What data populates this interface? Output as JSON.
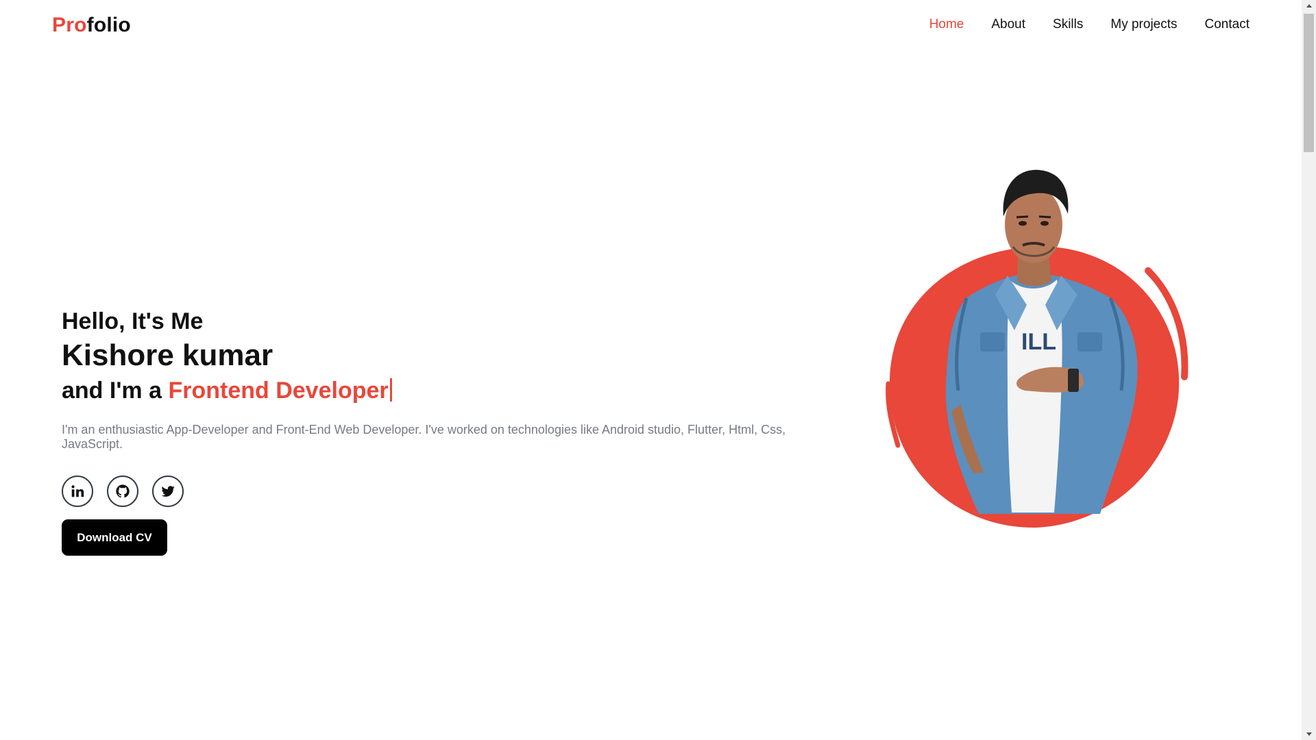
{
  "header": {
    "logo_accent": "Pro",
    "logo_rest": "folio",
    "nav": [
      {
        "label": "Home",
        "active": true
      },
      {
        "label": "About",
        "active": false
      },
      {
        "label": "Skills",
        "active": false
      },
      {
        "label": "My projects",
        "active": false
      },
      {
        "label": "Contact",
        "active": false
      }
    ]
  },
  "hero": {
    "greeting": "Hello, It's Me",
    "name": "Kishore kumar",
    "role_prefix": "and I'm a ",
    "role": "Frontend Developer",
    "bio": "I'm an enthusiastic App-Developer and Front-End Web Developer. I've worked on technologies like Android studio, Flutter, Html, Css, JavaScript.",
    "socials": [
      {
        "icon": "linkedin-icon"
      },
      {
        "icon": "github-icon"
      },
      {
        "icon": "twitter-icon"
      }
    ],
    "cv_button": "Download CV"
  },
  "colors": {
    "accent": "#e8473a",
    "text": "#111111",
    "muted": "#777a86",
    "button_bg": "#000000"
  }
}
